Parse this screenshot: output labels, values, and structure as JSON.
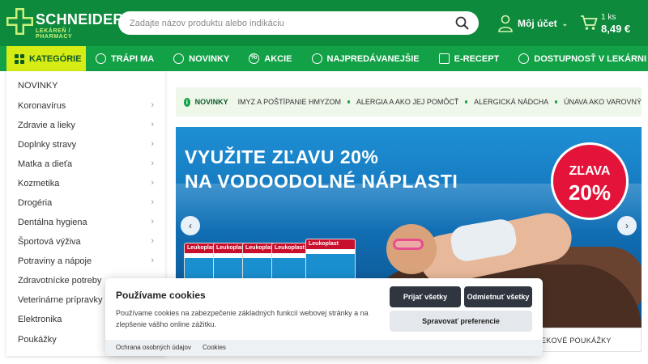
{
  "header": {
    "logo_title": "SCHNEIDER",
    "logo_subtitle": "LEKÁREŇ / PHARMACY",
    "search_placeholder": "Zadajte názov produktu alebo indikáciu",
    "account_label": "Môj účet",
    "cart_count": "1 ks",
    "cart_price": "8,49 €"
  },
  "nav": {
    "categories_label": "KATEGÓRIE",
    "items": [
      {
        "label": "TRÁPI MA",
        "icon": "pin-icon"
      },
      {
        "label": "NOVINKY",
        "icon": "new-icon"
      },
      {
        "label": "AKCIE",
        "icon": "percent-icon"
      },
      {
        "label": "NAJPREDÁVANEJŠIE",
        "icon": "top-icon"
      },
      {
        "label": "E-RECEPT",
        "icon": "document-icon"
      },
      {
        "label": "DOSTUPNOSŤ V LEKÁRNI",
        "icon": "location-icon"
      }
    ]
  },
  "sidebar": {
    "items": [
      {
        "label": "NOVINKY",
        "arrow": false
      },
      {
        "label": "Koronavírus",
        "arrow": true
      },
      {
        "label": "Zdravie a lieky",
        "arrow": true
      },
      {
        "label": "Doplnky stravy",
        "arrow": true
      },
      {
        "label": "Matka a dieťa",
        "arrow": true
      },
      {
        "label": "Kozmetika",
        "arrow": true
      },
      {
        "label": "Drogéria",
        "arrow": true
      },
      {
        "label": "Dentálna hygiena",
        "arrow": true
      },
      {
        "label": "Športová výživa",
        "arrow": true
      },
      {
        "label": "Potraviny a nápoje",
        "arrow": true
      },
      {
        "label": "Zdravotnícke potreby",
        "arrow": false
      },
      {
        "label": "Veterinárne prípravky",
        "arrow": false
      },
      {
        "label": "Elektronika",
        "arrow": false
      },
      {
        "label": "Poukážky",
        "arrow": false
      }
    ]
  },
  "tags": {
    "title": "NOVINKY",
    "items": [
      "IMYZ A POŠTÍPANIE HMYZOM",
      "ALERGIA A AKO JEJ POMÔCŤ",
      "ALERGICKÁ NÁDCHA",
      "ÚNAVA AKO VAROVNÝ"
    ]
  },
  "banner": {
    "headline_line1": "VYUŽITE ZĽAVU 20%",
    "headline_line2": "NA VODOODOLNÉ NÁPLASTI",
    "badge_line1": "ZĽAVA",
    "badge_line2": "20%",
    "product_brand": "Leukoplast",
    "prev_arrow": "‹",
    "next_arrow": "›"
  },
  "under_banner_text": "EKOVÉ POUKÁŽKY",
  "cookie": {
    "title": "Používame cookies",
    "description": "Používame cookies na zabezpečenie základných funkcií webovej stránky a na zlepšenie vášho online zážitku.",
    "accept_all": "Prijať všetky",
    "reject_all": "Odmietnuť všetky",
    "manage": "Spravovať preferencie",
    "privacy_link": "Ochrana osobných údajov",
    "cookies_link": "Cookies"
  },
  "colors": {
    "header_green": "#0e8a3c",
    "nav_green": "#12a146",
    "accent_lime": "#d6ec14",
    "badge_red": "#e3133a"
  }
}
